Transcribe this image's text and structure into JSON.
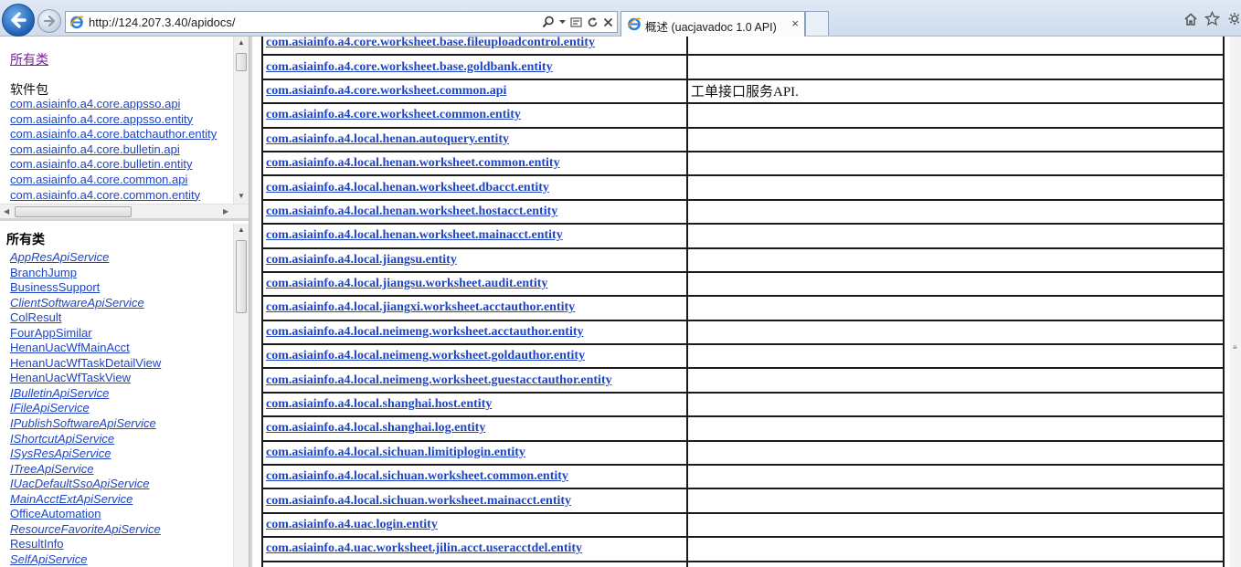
{
  "browser": {
    "address_url": "http://124.207.3.40/apidocs/",
    "tab_title": "概述 (uacjavadoc 1.0 API)",
    "tab_close": "×"
  },
  "package_frame": {
    "all_classes_link": "所有类",
    "heading": "软件包",
    "packages": [
      "com.asiainfo.a4.core.appsso.api",
      "com.asiainfo.a4.core.appsso.entity",
      "com.asiainfo.a4.core.batchauthor.entity",
      "com.asiainfo.a4.core.bulletin.api",
      "com.asiainfo.a4.core.bulletin.entity",
      "com.asiainfo.a4.core.common.api",
      "com.asiainfo.a4.core.common.entity"
    ]
  },
  "class_frame": {
    "heading": "所有类",
    "classes": [
      {
        "name": "AppResApiService",
        "interface": true
      },
      {
        "name": "BranchJump",
        "interface": false
      },
      {
        "name": "BusinessSupport",
        "interface": false
      },
      {
        "name": "ClientSoftwareApiService",
        "interface": true
      },
      {
        "name": "ColResult",
        "interface": false
      },
      {
        "name": "FourAppSimilar",
        "interface": false
      },
      {
        "name": "HenanUacWfMainAcct",
        "interface": false
      },
      {
        "name": "HenanUacWfTaskDetailView",
        "interface": false
      },
      {
        "name": "HenanUacWfTaskView",
        "interface": false
      },
      {
        "name": "IBulletinApiService",
        "interface": true
      },
      {
        "name": "IFileApiService",
        "interface": true
      },
      {
        "name": "IPublishSoftwareApiService",
        "interface": true
      },
      {
        "name": "IShortcutApiService",
        "interface": true
      },
      {
        "name": "ISysResApiService",
        "interface": true
      },
      {
        "name": "ITreeApiService",
        "interface": true
      },
      {
        "name": "IUacDefaultSsoApiService",
        "interface": true
      },
      {
        "name": "MainAcctExtApiService",
        "interface": true
      },
      {
        "name": "OfficeAutomation",
        "interface": false
      },
      {
        "name": "ResourceFavoriteApiService",
        "interface": true
      },
      {
        "name": "ResultInfo",
        "interface": false
      },
      {
        "name": "SelfApiService",
        "interface": true
      }
    ]
  },
  "package_table": {
    "rows": [
      {
        "name": "com.asiainfo.a4.core.worksheet.base.fileuploadcontrol.entity",
        "desc": ""
      },
      {
        "name": "com.asiainfo.a4.core.worksheet.base.goldbank.entity",
        "desc": ""
      },
      {
        "name": "com.asiainfo.a4.core.worksheet.common.api",
        "desc": "工单接口服务API."
      },
      {
        "name": "com.asiainfo.a4.core.worksheet.common.entity",
        "desc": ""
      },
      {
        "name": "com.asiainfo.a4.local.henan.autoquery.entity",
        "desc": ""
      },
      {
        "name": "com.asiainfo.a4.local.henan.worksheet.common.entity",
        "desc": ""
      },
      {
        "name": "com.asiainfo.a4.local.henan.worksheet.dbacct.entity",
        "desc": ""
      },
      {
        "name": "com.asiainfo.a4.local.henan.worksheet.hostacct.entity",
        "desc": ""
      },
      {
        "name": "com.asiainfo.a4.local.henan.worksheet.mainacct.entity",
        "desc": ""
      },
      {
        "name": "com.asiainfo.a4.local.jiangsu.entity",
        "desc": ""
      },
      {
        "name": "com.asiainfo.a4.local.jiangsu.worksheet.audit.entity",
        "desc": ""
      },
      {
        "name": "com.asiainfo.a4.local.jiangxi.worksheet.acctauthor.entity",
        "desc": ""
      },
      {
        "name": "com.asiainfo.a4.local.neimeng.worksheet.acctauthor.entity",
        "desc": ""
      },
      {
        "name": "com.asiainfo.a4.local.neimeng.worksheet.goldauthor.entity",
        "desc": ""
      },
      {
        "name": "com.asiainfo.a4.local.neimeng.worksheet.guestacctauthor.entity",
        "desc": ""
      },
      {
        "name": "com.asiainfo.a4.local.shanghai.host.entity",
        "desc": ""
      },
      {
        "name": "com.asiainfo.a4.local.shanghai.log.entity",
        "desc": ""
      },
      {
        "name": "com.asiainfo.a4.local.sichuan.limitiplogin.entity",
        "desc": ""
      },
      {
        "name": "com.asiainfo.a4.local.sichuan.worksheet.common.entity",
        "desc": ""
      },
      {
        "name": "com.asiainfo.a4.local.sichuan.worksheet.mainacct.entity",
        "desc": ""
      },
      {
        "name": "com.asiainfo.a4.uac.login.entity",
        "desc": ""
      },
      {
        "name": "com.asiainfo.a4.uac.worksheet.jilin.acct.useracctdel.entity",
        "desc": ""
      },
      {
        "name": "",
        "desc": ""
      }
    ]
  }
}
